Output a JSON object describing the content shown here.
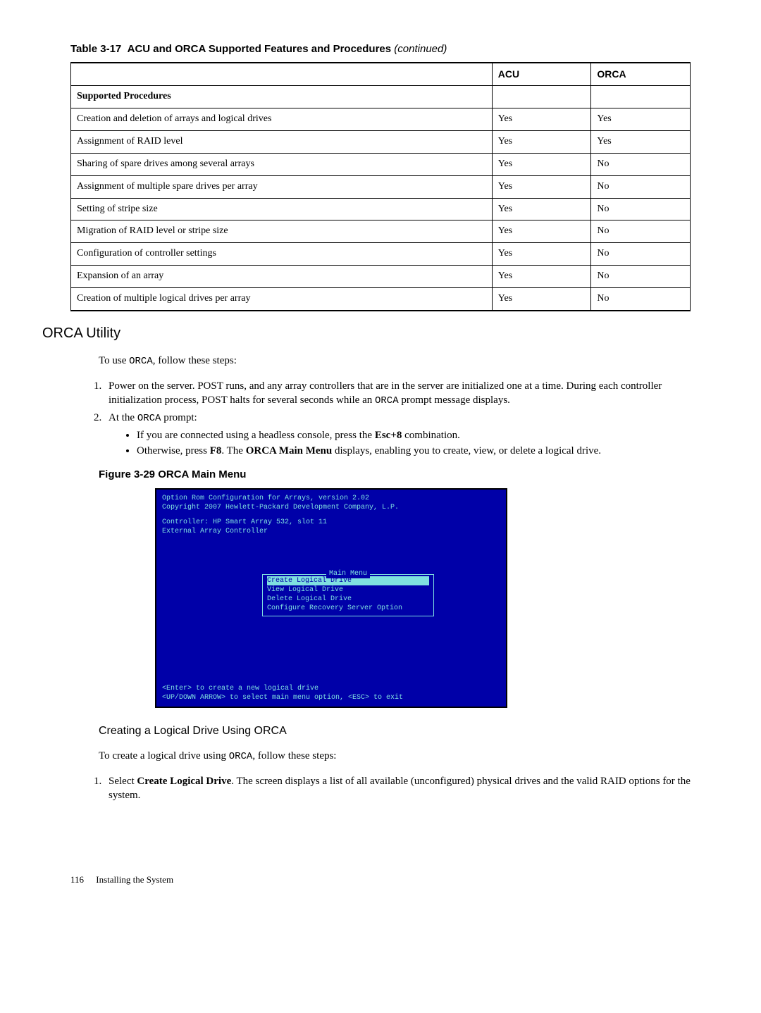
{
  "table": {
    "title_prefix": "Table 3-17",
    "title_text": "ACU and ORCA Supported Features and Procedures",
    "title_suffix": "(continued)",
    "head_blank": "",
    "head_acu": "ACU",
    "head_orca": "ORCA",
    "rows": [
      {
        "label": "Supported Procedures",
        "acu": "",
        "orca": "",
        "bold": true
      },
      {
        "label": "Creation and deletion of arrays and logical drives",
        "acu": "Yes",
        "orca": "Yes"
      },
      {
        "label": "Assignment of RAID level",
        "acu": "Yes",
        "orca": "Yes"
      },
      {
        "label": "Sharing of spare drives among several arrays",
        "acu": "Yes",
        "orca": "No"
      },
      {
        "label": "Assignment of multiple spare drives per array",
        "acu": "Yes",
        "orca": "No"
      },
      {
        "label": "Setting of stripe size",
        "acu": "Yes",
        "orca": "No"
      },
      {
        "label": "Migration of RAID level or stripe size",
        "acu": "Yes",
        "orca": "No"
      },
      {
        "label": "Configuration of controller settings",
        "acu": "Yes",
        "orca": "No"
      },
      {
        "label": "Expansion of an array",
        "acu": "Yes",
        "orca": "No"
      },
      {
        "label": "Creation of multiple logical drives per array",
        "acu": "Yes",
        "orca": "No"
      }
    ]
  },
  "orca": {
    "heading": "ORCA Utility",
    "intro_pre": "To use ",
    "intro_code": "ORCA",
    "intro_post": ", follow these steps:",
    "step1": "Power on the server. POST runs, and any array controllers that are in the server are initialized one at a time. During each controller initialization process, POST halts for several seconds while an ",
    "step1_code": "ORCA",
    "step1_post": " prompt message displays.",
    "step2_pre": "At the ",
    "step2_code": "ORCA",
    "step2_post": " prompt:",
    "bullet1_pre": "If you are connected using a headless console, press the ",
    "bullet1_bold": "Esc+8",
    "bullet1_post": " combination.",
    "bullet2_pre": "Otherwise, press ",
    "bullet2_bold1": "F8",
    "bullet2_mid": ". The ",
    "bullet2_bold2": "ORCA Main Menu",
    "bullet2_post": " displays, enabling you to create, view, or delete a logical drive."
  },
  "figure": {
    "title": "Figure 3-29  ORCA Main Menu",
    "line1": "Option Rom Configuration for Arrays, version  2.02",
    "line2": "Copyright 2007 Hewlett-Packard Development Company, L.P.",
    "line3": "Controller: HP Smart Array 532, slot 11",
    "line4": "External Array Controller",
    "menu_title": "Main Menu",
    "menu_items": [
      "Create Logical Drive",
      "View Logical Drive",
      "Delete Logical Drive",
      "Configure Recovery Server Option"
    ],
    "bottom1": "<Enter> to create a new logical drive",
    "bottom2": "<UP/DOWN ARROW> to select main menu option, <ESC> to exit"
  },
  "create": {
    "heading": "Creating a Logical Drive Using ORCA",
    "intro_pre": "To create a logical drive using ",
    "intro_code": "ORCA",
    "intro_post": ", follow these steps:",
    "step1_pre": "Select ",
    "step1_bold": "Create Logical Drive",
    "step1_post": ". The screen displays a list of all available (unconfigured) physical drives and the valid RAID options for the system."
  },
  "footer": {
    "page": "116",
    "label": "Installing the System"
  }
}
